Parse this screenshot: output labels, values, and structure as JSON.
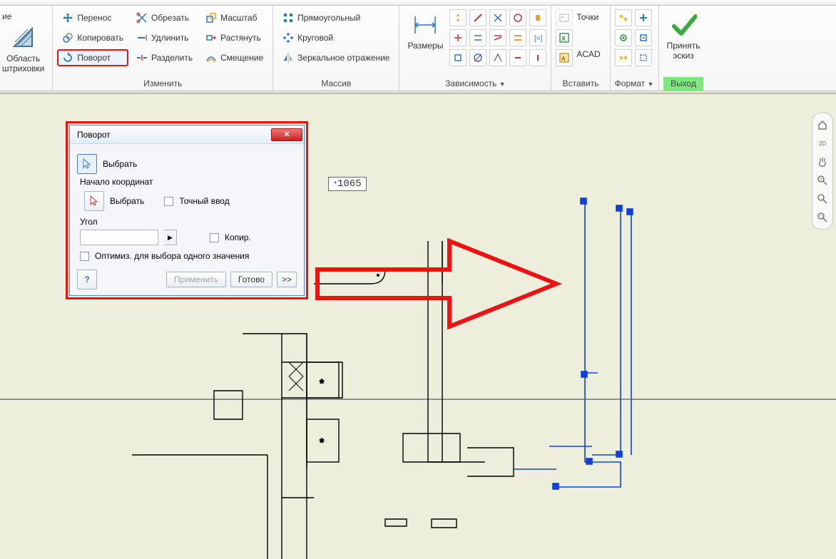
{
  "ribbon": {
    "group_hatch": {
      "big_label_l1": "ие",
      "big_label_l2": "Область",
      "big_label_l3": "штриховки"
    },
    "group_modify": {
      "label": "Изменить",
      "move": "Перенос",
      "copy": "Копировать",
      "rotate": "Поворот",
      "trim": "Обрезать",
      "extend": "Удлинить",
      "split": "Разделить",
      "scale": "Масштаб",
      "stretch": "Растянуть",
      "offset": "Смещение"
    },
    "group_array": {
      "label": "Массив",
      "rect": "Прямоугольный",
      "circ": "Круговой",
      "mirror": "Зеркальное отражение"
    },
    "group_dimension": {
      "label": "Размеры",
      "dropdown": "Зависимость"
    },
    "group_insert": {
      "label": "Вставить",
      "points": "Точки",
      "acad": "ACAD"
    },
    "group_format": {
      "label": "Формат"
    },
    "group_exit": {
      "label": "Выход",
      "finish_l1": "Принять",
      "finish_l2": "эскиз"
    }
  },
  "canvas": {
    "dim_value": "1065"
  },
  "dialog": {
    "title": "Поворот",
    "select": "Выбрать",
    "origin_label": "Начало координат",
    "origin_select": "Выбрать",
    "precise": "Точный ввод",
    "angle_label": "Угол",
    "copy": "Копир.",
    "optimize": "Оптимиз. для выбора одного значения",
    "apply": "Применить",
    "done": "Готово",
    "expand": ">>"
  }
}
